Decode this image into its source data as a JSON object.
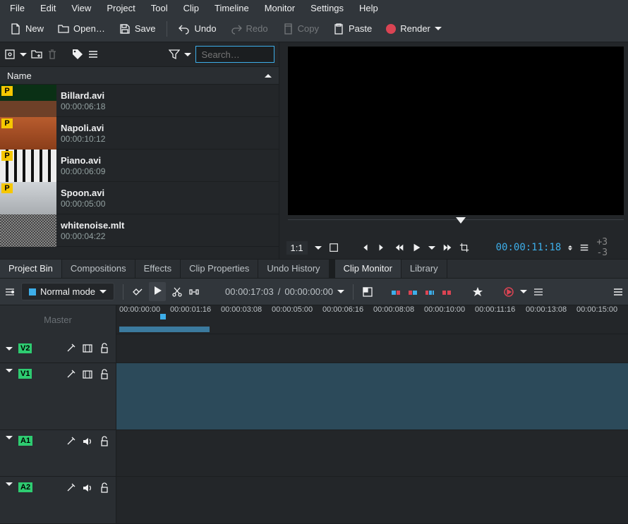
{
  "menu": [
    "File",
    "Edit",
    "View",
    "Project",
    "Tool",
    "Clip",
    "Timeline",
    "Monitor",
    "Settings",
    "Help"
  ],
  "toolbar": {
    "new": "New",
    "open": "Open…",
    "save": "Save",
    "undo": "Undo",
    "redo": "Redo",
    "copy": "Copy",
    "paste": "Paste",
    "render": "Render"
  },
  "bin": {
    "search_placeholder": "Search…",
    "name_header": "Name",
    "clips": [
      {
        "name": "Billard.avi",
        "duration": "00:00:06:18",
        "proxy": true
      },
      {
        "name": "Napoli.avi",
        "duration": "00:00:10:12",
        "proxy": true
      },
      {
        "name": "Piano.avi",
        "duration": "00:00:06:09",
        "proxy": true
      },
      {
        "name": "Spoon.avi",
        "duration": "00:00:05:00",
        "proxy": true
      },
      {
        "name": "whitenoise.mlt",
        "duration": "00:00:04:22",
        "proxy": false
      }
    ]
  },
  "monitor": {
    "ratio": "1:1",
    "timecode": "00:00:11:18",
    "frames": "+3 -3"
  },
  "tabs_left": [
    "Project Bin",
    "Compositions",
    "Effects",
    "Clip Properties",
    "Undo History"
  ],
  "tabs_right": [
    "Clip Monitor",
    "Library"
  ],
  "active_tab_left": "Project Bin",
  "active_tab_right": "Clip Monitor",
  "timeline_toolbar": {
    "mode": "Normal mode",
    "position": "00:00:17:03",
    "duration": "00:00:00:00"
  },
  "ruler": [
    "00:00:00:00",
    "00:00:01:16",
    "00:00:03:08",
    "00:00:05:00",
    "00:00:06:16",
    "00:00:08:08",
    "00:00:10:00",
    "00:00:11:16",
    "00:00:13:08",
    "00:00:15:00"
  ],
  "tracks": {
    "master": "Master",
    "v2": "V2",
    "v1": "V1",
    "a1": "A1",
    "a2": "A2"
  }
}
